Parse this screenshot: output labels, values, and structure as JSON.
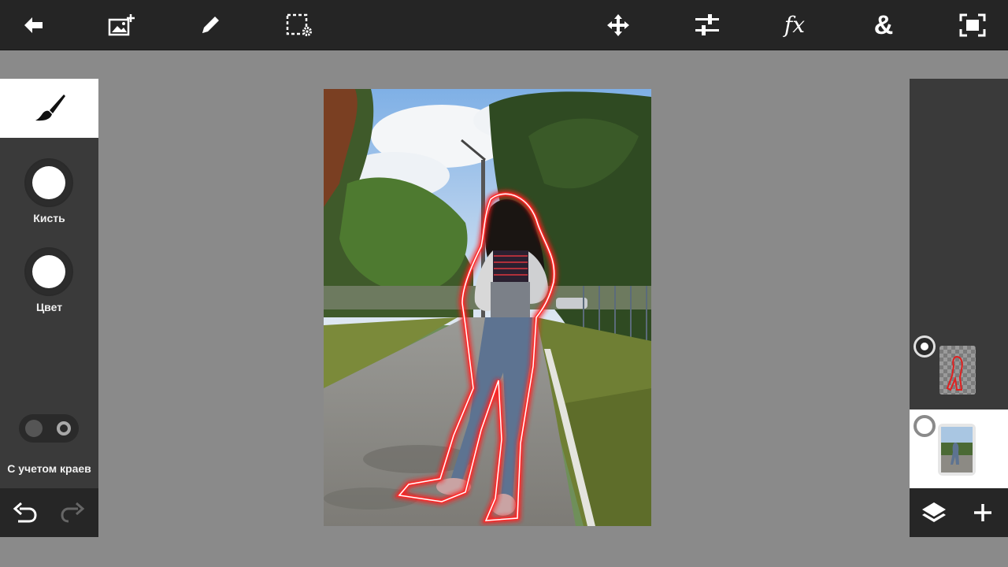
{
  "toolbar": {
    "left_icons": [
      "back-arrow-icon",
      "add-image-icon",
      "pencil-icon",
      "selection-settings-icon"
    ],
    "right_icons": [
      "move-icon",
      "adjustments-icon",
      "fx-icon",
      "ampersand-icon",
      "fit-screen-icon"
    ],
    "fx_label": "fx",
    "amp_label": "&"
  },
  "left_panel": {
    "active_tool_icon": "brush-icon",
    "brush_label": "Кисть",
    "color_label": "Цвет",
    "edge_aware_label": "С учетом краев",
    "undo_icon": "undo-icon",
    "redo_icon": "redo-icon"
  },
  "canvas": {
    "description_icons": [
      "photo-canvas"
    ]
  },
  "layers": {
    "items": [
      {
        "kind": "selection-outline",
        "selected": false
      },
      {
        "kind": "photo",
        "selected": true
      }
    ],
    "layers_icon": "layers-icon",
    "add_icon": "plus-icon"
  }
}
